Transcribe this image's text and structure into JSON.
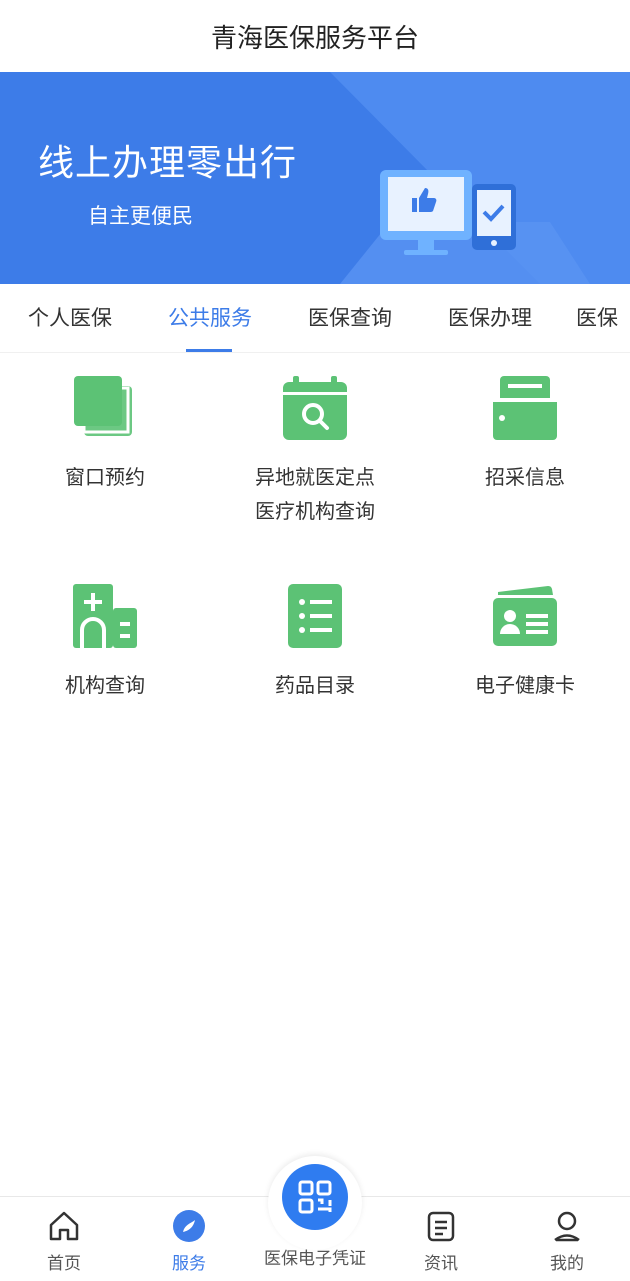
{
  "header": {
    "title": "青海医保服务平台"
  },
  "banner": {
    "title": "线上办理零出行",
    "subtitle": "自主更便民"
  },
  "tabs": [
    {
      "label": "个人医保"
    },
    {
      "label": "公共服务"
    },
    {
      "label": "医保查询"
    },
    {
      "label": "医保办理"
    },
    {
      "label": "医保"
    }
  ],
  "services": [
    {
      "label": "窗口预约",
      "icon": "copy-icon"
    },
    {
      "label": "异地就医定点\n医疗机构查询",
      "icon": "calendar-search-icon"
    },
    {
      "label": "招采信息",
      "icon": "folder-icon"
    },
    {
      "label": "机构查询",
      "icon": "hospital-building-icon"
    },
    {
      "label": "药品目录",
      "icon": "list-icon"
    },
    {
      "label": "电子健康卡",
      "icon": "id-card-icon"
    }
  ],
  "bottom_nav": {
    "home": "首页",
    "service": "服务",
    "center": "医保电子凭证",
    "news": "资讯",
    "mine": "我的"
  },
  "colors": {
    "accent": "#3d7ce8",
    "icon_green": "#5cc275"
  }
}
